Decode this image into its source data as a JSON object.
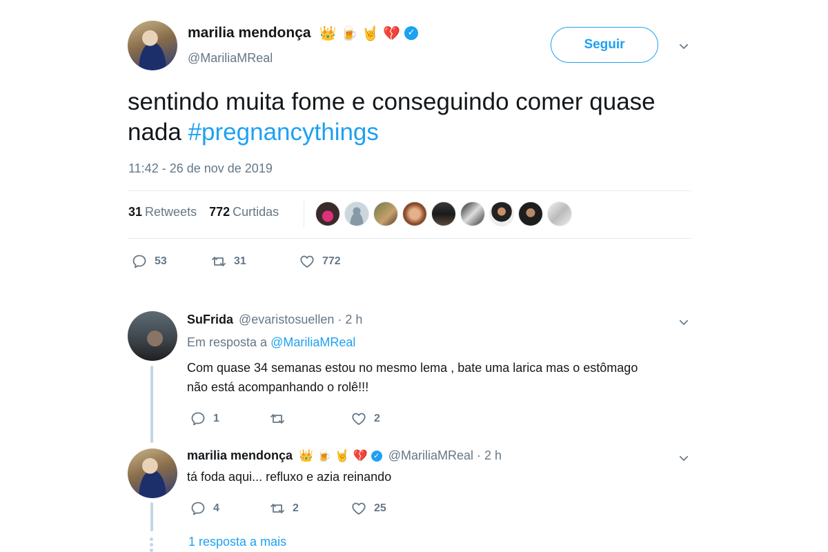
{
  "main_tweet": {
    "display_name": "marilia mendonça",
    "name_emojis": [
      "👑",
      "🍺",
      "🤘",
      "💔"
    ],
    "handle": "@MariliaMReal",
    "follow_label": "Seguir",
    "text": "sentindo muita fome e conseguindo comer quase nada ",
    "hashtag": "#pregnancythings",
    "timestamp": "11:42 - 26 de nov de 2019",
    "retweets_count": "31",
    "retweets_label": "Retweets",
    "likes_count": "772",
    "likes_label": "Curtidas",
    "actions": {
      "replies": "53",
      "retweets": "31",
      "likes": "772"
    }
  },
  "replies": [
    {
      "name": "SuFrida",
      "handle_time": "@evaristosuellen · 2 h",
      "in_reply_prefix": "Em resposta a ",
      "in_reply_handle": "@MariliaMReal",
      "text_line1": "Com quase 34 semanas estou no mesmo lema , bate uma larica mas o estômago",
      "text_line2": "não está acompanhando o rolê!!!",
      "actions": {
        "replies": "1",
        "retweets": "",
        "likes": "2"
      }
    },
    {
      "name": "marilia mendonça",
      "name_emojis": [
        "👑",
        "🍺",
        "🤘",
        "💔"
      ],
      "handle_time": "@MariliaMReal · 2 h",
      "text_line1": "tá foda aqui... refluxo e azia reinando",
      "actions": {
        "replies": "4",
        "retweets": "2",
        "likes": "25"
      }
    }
  ],
  "more_replies_label": "1 resposta a mais",
  "colors": {
    "accent": "#1da1f2",
    "text": "#14171a",
    "muted": "#657786",
    "divider": "#e6ecf0",
    "heart_broken": "#e0245e"
  },
  "liker_avatars": [
    "avatar-1",
    "avatar-2",
    "avatar-3",
    "avatar-4",
    "avatar-5",
    "avatar-6",
    "avatar-7",
    "avatar-8",
    "avatar-9"
  ]
}
